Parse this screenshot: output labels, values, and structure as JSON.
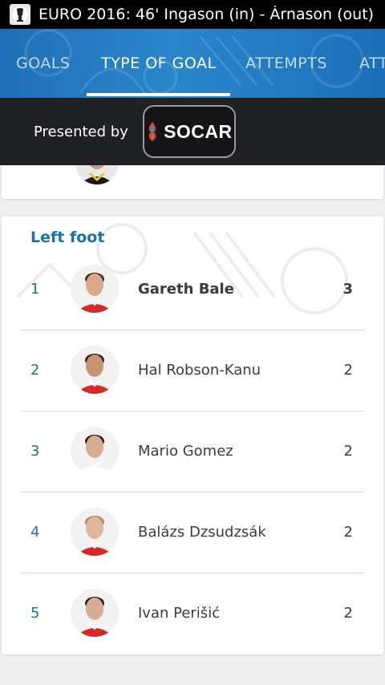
{
  "status_bar": {
    "text": "EURO 2016: 46' Ingason (in) - Árnason (out)",
    "icon": "euro-trophy-icon"
  },
  "tabs": [
    {
      "label": "GOALS",
      "active": false
    },
    {
      "label": "TYPE OF GOAL",
      "active": true
    },
    {
      "label": "ATTEMPTS",
      "active": false
    },
    {
      "label": "ATT",
      "active": false
    }
  ],
  "sponsor": {
    "presented_by": "Presented by",
    "logo_text": "SOCAR",
    "logo_icon": "flame-icon"
  },
  "section": {
    "title": "Left foot",
    "rows": [
      {
        "rank": "1",
        "name": "Gareth Bale",
        "value": "3",
        "highlight": true
      },
      {
        "rank": "2",
        "name": "Hal Robson-Kanu",
        "value": "2",
        "highlight": false
      },
      {
        "rank": "3",
        "name": "Mario Gomez",
        "value": "2",
        "highlight": false
      },
      {
        "rank": "4",
        "name": "Balázs Dzsudzsák",
        "value": "2",
        "highlight": false
      },
      {
        "rank": "5",
        "name": "Ivan Perišić",
        "value": "2",
        "highlight": false
      }
    ]
  },
  "colors": {
    "accent_blue": "#1f6fa8",
    "tab_bar": "#2a86cc",
    "sponsor_bar": "#202124"
  }
}
